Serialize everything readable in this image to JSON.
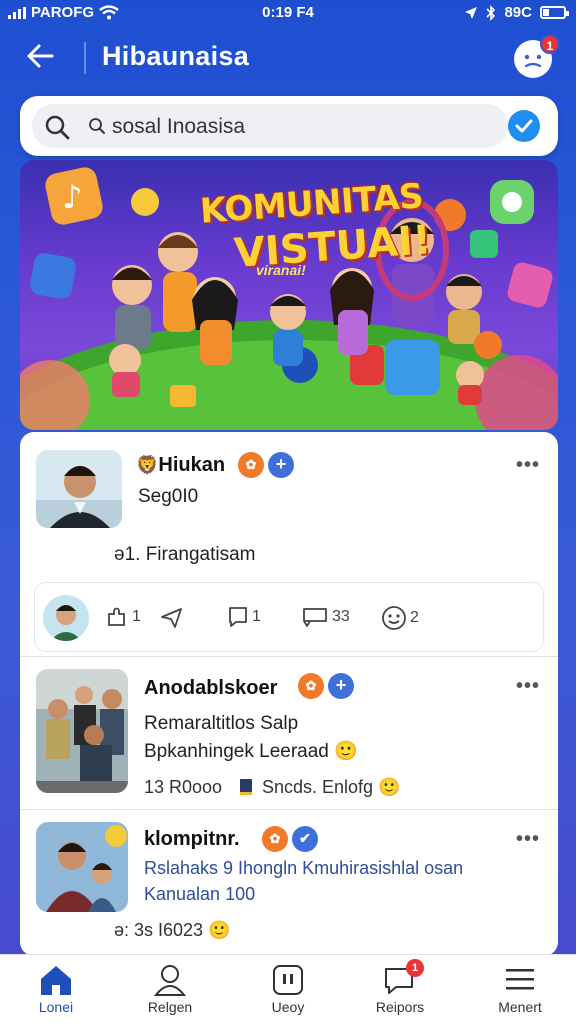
{
  "status_bar": {
    "carrier": "PAROFG",
    "time": "0:19 F4",
    "battery_text": "89C"
  },
  "header": {
    "title": "Hibaunaisa",
    "notification_count": "1"
  },
  "search": {
    "text": "sosal Inoasisa"
  },
  "banner": {
    "title": "KOMUNITAS",
    "subtitle": "VISTUAI!",
    "tag": "viranai!"
  },
  "posts": [
    {
      "name": "Hiukan",
      "badge": "✿",
      "subtitle": "Seg0I0",
      "body": "ə1. Firangatisam",
      "actions": [
        {
          "icon": "puzzle-icon",
          "count": "1"
        },
        {
          "icon": "share-icon",
          "count": ""
        },
        {
          "icon": "comment-icon",
          "count": "1"
        },
        {
          "icon": "message-icon",
          "count": "33"
        },
        {
          "icon": "emoji-icon",
          "count": "2"
        }
      ]
    },
    {
      "name": "Anodablskoer",
      "badge": "✿",
      "line1": "Remaraltitlos Salp",
      "line2": "Bpkanhingek Leeraad",
      "meta_left": "13 R0ooo",
      "meta_right": "Sncds. Enlofg"
    },
    {
      "name": "klompitnr.",
      "badge": "✿",
      "line1": "Rslahaks 9 Ihongln Kmuhirasishlal osan",
      "line2": "Kanualan 100",
      "meta_left": "ə: 3s I6023"
    }
  ],
  "nav": [
    {
      "label": "Lonei",
      "icon": "home-icon",
      "active": true
    },
    {
      "label": "Relgen",
      "icon": "profile-icon",
      "active": false
    },
    {
      "label": "Ueoy",
      "icon": "apps-icon",
      "active": false
    },
    {
      "label": "Reipors",
      "icon": "chat-icon",
      "active": false,
      "badge": "1"
    },
    {
      "label": "Menert",
      "icon": "menu-icon",
      "active": false
    }
  ],
  "colors": {
    "accent": "#1f4fb8",
    "badge": "#e83535",
    "orange": "#f07a28"
  }
}
